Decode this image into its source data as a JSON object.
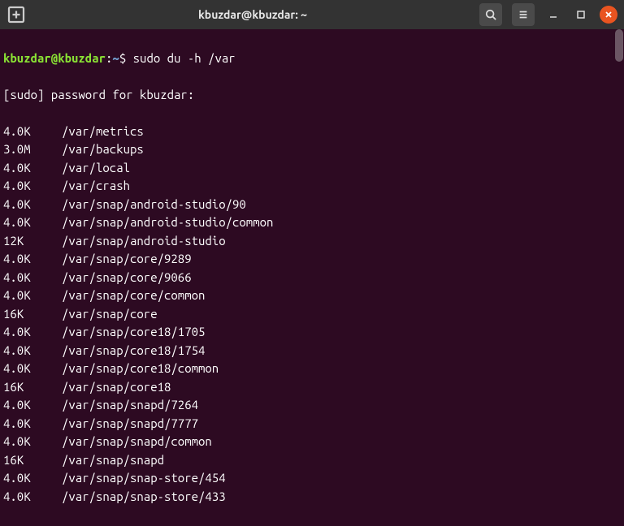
{
  "titlebar": {
    "title": "kbuzdar@kbuzdar: ~"
  },
  "prompt": {
    "user_host": "kbuzdar@kbuzdar",
    "colon": ":",
    "path": "~",
    "dollar": "$ ",
    "command": "sudo du -h /var"
  },
  "sudo_line": "[sudo] password for kbuzdar:",
  "output": [
    {
      "size": "4.0K",
      "path": "/var/metrics"
    },
    {
      "size": "3.0M",
      "path": "/var/backups"
    },
    {
      "size": "4.0K",
      "path": "/var/local"
    },
    {
      "size": "4.0K",
      "path": "/var/crash"
    },
    {
      "size": "4.0K",
      "path": "/var/snap/android-studio/90"
    },
    {
      "size": "4.0K",
      "path": "/var/snap/android-studio/common"
    },
    {
      "size": "12K",
      "path": "/var/snap/android-studio"
    },
    {
      "size": "4.0K",
      "path": "/var/snap/core/9289"
    },
    {
      "size": "4.0K",
      "path": "/var/snap/core/9066"
    },
    {
      "size": "4.0K",
      "path": "/var/snap/core/common"
    },
    {
      "size": "16K",
      "path": "/var/snap/core"
    },
    {
      "size": "4.0K",
      "path": "/var/snap/core18/1705"
    },
    {
      "size": "4.0K",
      "path": "/var/snap/core18/1754"
    },
    {
      "size": "4.0K",
      "path": "/var/snap/core18/common"
    },
    {
      "size": "16K",
      "path": "/var/snap/core18"
    },
    {
      "size": "4.0K",
      "path": "/var/snap/snapd/7264"
    },
    {
      "size": "4.0K",
      "path": "/var/snap/snapd/7777"
    },
    {
      "size": "4.0K",
      "path": "/var/snap/snapd/common"
    },
    {
      "size": "16K",
      "path": "/var/snap/snapd"
    },
    {
      "size": "4.0K",
      "path": "/var/snap/snap-store/454"
    },
    {
      "size": "4.0K",
      "path": "/var/snap/snap-store/433"
    }
  ]
}
